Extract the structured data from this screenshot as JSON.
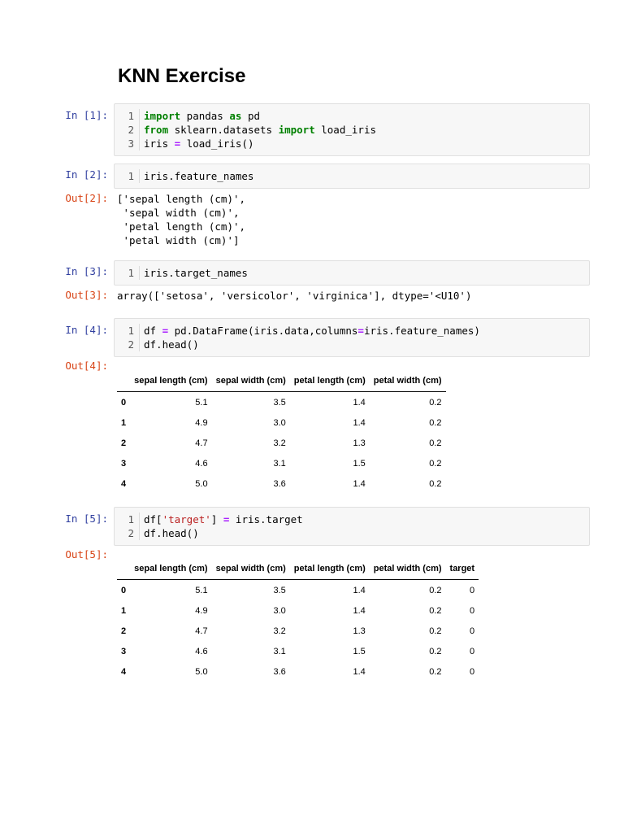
{
  "title": "KNN Exercise",
  "cells": [
    {
      "prompt": "In [1]:",
      "lines": [
        [
          {
            "t": "import",
            "c": "kw"
          },
          {
            "t": " pandas ",
            "c": "plain"
          },
          {
            "t": "as",
            "c": "kw"
          },
          {
            "t": " pd",
            "c": "plain"
          }
        ],
        [
          {
            "t": "from",
            "c": "kw"
          },
          {
            "t": " sklearn.datasets ",
            "c": "plain"
          },
          {
            "t": "import",
            "c": "kw"
          },
          {
            "t": " load_iris",
            "c": "plain"
          }
        ],
        [
          {
            "t": "iris ",
            "c": "plain"
          },
          {
            "t": "=",
            "c": "op"
          },
          {
            "t": " load_iris()",
            "c": "plain"
          }
        ]
      ]
    },
    {
      "prompt": "In [2]:",
      "lines": [
        [
          {
            "t": "iris.feature_names",
            "c": "plain"
          }
        ]
      ],
      "out_prompt": "Out[2]:",
      "out_text": "['sepal length (cm)',\n 'sepal width (cm)',\n 'petal length (cm)',\n 'petal width (cm)']"
    },
    {
      "prompt": "In [3]:",
      "lines": [
        [
          {
            "t": "iris.target_names",
            "c": "plain"
          }
        ]
      ],
      "out_prompt": "Out[3]:",
      "out_text": "array(['setosa', 'versicolor', 'virginica'], dtype='<U10')"
    },
    {
      "prompt": "In [4]:",
      "lines": [
        [
          {
            "t": "df ",
            "c": "plain"
          },
          {
            "t": "=",
            "c": "op"
          },
          {
            "t": " pd.DataFrame(iris.data,columns",
            "c": "plain"
          },
          {
            "t": "=",
            "c": "op"
          },
          {
            "t": "iris.feature_names)",
            "c": "plain"
          }
        ],
        [
          {
            "t": "df.head()",
            "c": "plain"
          }
        ]
      ],
      "out_prompt": "Out[4]:"
    },
    {
      "prompt": "In [5]:",
      "lines": [
        [
          {
            "t": "df[",
            "c": "plain"
          },
          {
            "t": "'target'",
            "c": "str"
          },
          {
            "t": "] ",
            "c": "plain"
          },
          {
            "t": "=",
            "c": "op"
          },
          {
            "t": " iris.target",
            "c": "plain"
          }
        ],
        [
          {
            "t": "df.head()",
            "c": "plain"
          }
        ]
      ],
      "out_prompt": "Out[5]:"
    }
  ],
  "table4": {
    "columns": [
      "",
      "sepal length (cm)",
      "sepal width (cm)",
      "petal length (cm)",
      "petal width (cm)"
    ],
    "rows": [
      [
        "0",
        "5.1",
        "3.5",
        "1.4",
        "0.2"
      ],
      [
        "1",
        "4.9",
        "3.0",
        "1.4",
        "0.2"
      ],
      [
        "2",
        "4.7",
        "3.2",
        "1.3",
        "0.2"
      ],
      [
        "3",
        "4.6",
        "3.1",
        "1.5",
        "0.2"
      ],
      [
        "4",
        "5.0",
        "3.6",
        "1.4",
        "0.2"
      ]
    ]
  },
  "table5": {
    "columns": [
      "",
      "sepal length (cm)",
      "sepal width (cm)",
      "petal length (cm)",
      "petal width (cm)",
      "target"
    ],
    "rows": [
      [
        "0",
        "5.1",
        "3.5",
        "1.4",
        "0.2",
        "0"
      ],
      [
        "1",
        "4.9",
        "3.0",
        "1.4",
        "0.2",
        "0"
      ],
      [
        "2",
        "4.7",
        "3.2",
        "1.3",
        "0.2",
        "0"
      ],
      [
        "3",
        "4.6",
        "3.1",
        "1.5",
        "0.2",
        "0"
      ],
      [
        "4",
        "5.0",
        "3.6",
        "1.4",
        "0.2",
        "0"
      ]
    ]
  }
}
